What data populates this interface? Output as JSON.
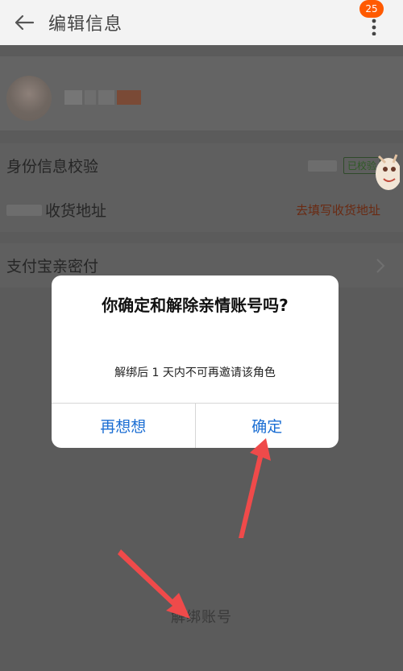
{
  "header": {
    "title": "编辑信息",
    "back_icon": "arrow-left-icon",
    "more_icon": "more-vertical-icon",
    "notification_count": "25"
  },
  "info_rows": {
    "identity": {
      "label": "身份信息校验",
      "status": "已校验"
    },
    "address": {
      "label": "收货地址",
      "action": "去填写收货地址"
    },
    "alipay": {
      "label": "支付宝亲密付"
    }
  },
  "footer": {
    "unbind_label": "解绑账号"
  },
  "dialog": {
    "title": "你确定和解除亲情账号吗?",
    "message": "解绑后 1 天内不可再邀请该角色",
    "cancel_label": "再想想",
    "confirm_label": "确定"
  },
  "colors": {
    "accent_blue": "#1b6ed3",
    "badge_orange": "#ff5a00",
    "arrow_red": "#ef4a4a"
  }
}
